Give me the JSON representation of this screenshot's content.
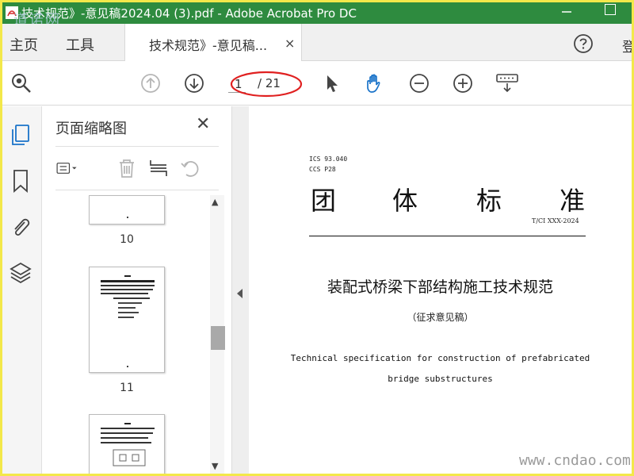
{
  "window": {
    "title": "技术规范》-意见稿2024.04 (3).pdf - Adobe Acrobat Pro DC",
    "watermark_top": "道诺网",
    "watermark_bottom": "www.cndao.com"
  },
  "menu": {
    "home": "主页",
    "tools": "工具",
    "doc_tab": "技术规范》-意见稿...",
    "doc_tab_close": "×",
    "login": "登"
  },
  "toolbar": {
    "current_page": "1",
    "total_pages": "/ 21",
    "icons": [
      "search-icon",
      "prev-page-icon",
      "next-page-icon",
      "select-pointer-icon",
      "hand-tool-icon",
      "zoom-out-icon",
      "zoom-in-icon",
      "keyboard-icon"
    ]
  },
  "thumbnail_panel": {
    "title": "页面缩略图",
    "close": "✕",
    "pages": [
      "10",
      "11"
    ]
  },
  "document": {
    "ics": "ICS 93.040",
    "ccs": "CCS P28",
    "heading_chars": [
      "团",
      "体",
      "标",
      "准"
    ],
    "code": "T/CI XXX-2024",
    "title": "装配式桥梁下部结构施工技术规范",
    "subtitle": "（征求意见稿）",
    "english_line1": "Technical specification for construction of prefabricated",
    "english_line2": "bridge substructures"
  },
  "colors": {
    "titlebar": "#2e8b3f",
    "border": "#f3e84a",
    "accent_blue": "#1a73c9",
    "annotation_red": "#e02020"
  }
}
